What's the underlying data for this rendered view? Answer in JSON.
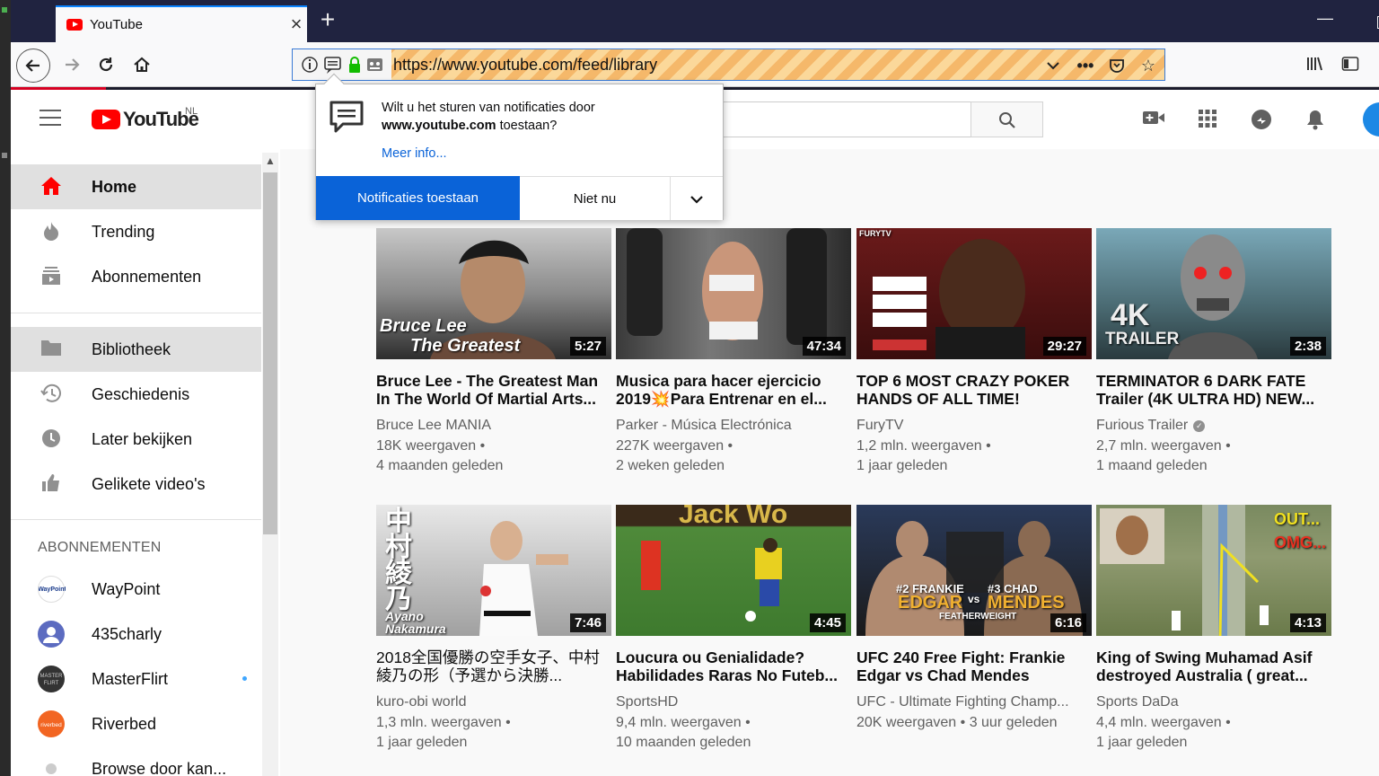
{
  "browser": {
    "tab_title": "YouTube",
    "url": "https://www.youtube.com/feed/library"
  },
  "notification": {
    "message_pre": "Wilt u het sturen van notificaties door",
    "domain": "www.youtube.com",
    "message_post": " toestaan?",
    "more_info": "Meer info...",
    "allow_label": "Notificaties toestaan",
    "not_now_label": "Niet nu"
  },
  "youtube": {
    "logo_word": "YouTube",
    "region": "NL"
  },
  "sidebar": {
    "items": [
      {
        "label": "Home",
        "icon": "home-icon"
      },
      {
        "label": "Trending",
        "icon": "flame-icon"
      },
      {
        "label": "Abonnementen",
        "icon": "subscriptions-icon"
      },
      {
        "label": "Bibliotheek",
        "icon": "folder-icon"
      },
      {
        "label": "Geschiedenis",
        "icon": "history-icon"
      },
      {
        "label": "Later bekijken",
        "icon": "clock-icon"
      },
      {
        "label": "Gelikete video's",
        "icon": "thumbs-up-icon"
      }
    ],
    "subs_heading": "ABONNEMENTEN",
    "subscriptions": [
      {
        "label": "WayPoint"
      },
      {
        "label": "435charly"
      },
      {
        "label": "MasterFlirt"
      },
      {
        "label": "Riverbed"
      },
      {
        "label": "Browse door kan..."
      }
    ]
  },
  "videos": [
    {
      "title": "Bruce Lee - The Greatest Man In The World Of Martial Arts...",
      "channel": "Bruce Lee MANIA",
      "views": "18K weergaven",
      "age": "4 maanden geleden",
      "duration": "5:27",
      "overlay": "Bruce Lee\nThe Greatest"
    },
    {
      "title": "Musica para hacer ejercicio 2019💥Para Entrenar en el...",
      "channel": "Parker - Música Electrónica",
      "views": "227K weergaven",
      "age": "2 weken geleden",
      "duration": "47:34",
      "overlay": ""
    },
    {
      "title": "TOP 6 MOST CRAZY POKER HANDS OF ALL TIME!",
      "channel": "FuryTV",
      "views": "1,2 mln. weergaven",
      "age": "1 jaar geleden",
      "duration": "29:27",
      "overlay": "FURYTV"
    },
    {
      "title": "TERMINATOR 6 DARK FATE Trailer (4K ULTRA HD) NEW...",
      "channel": "Furious Trailer",
      "views": "2,7 mln. weergaven",
      "age": "1 maand geleden",
      "duration": "2:38",
      "overlay": "4K TRAILER"
    },
    {
      "title": "2018全国優勝の空手女子、中村綾乃の形（予選から決勝...",
      "channel": "kuro-obi world",
      "views": "1,3 mln. weergaven",
      "age": "1 jaar geleden",
      "duration": "7:46",
      "overlay": "中村綾乃"
    },
    {
      "title": "Loucura ou Genialidade? Habilidades Raras No Futeb...",
      "channel": "SportsHD",
      "views": "9,4 mln. weergaven",
      "age": "10 maanden geleden",
      "duration": "4:45",
      "overlay": ""
    },
    {
      "title": "UFC 240 Free Fight: Frankie Edgar vs Chad Mendes",
      "channel": "UFC - Ultimate Fighting Champ...",
      "views": "20K weergaven",
      "age": "3 uur geleden",
      "duration": "6:16",
      "overlay": "#2 FRANKIE EDGAR vs #3 CHAD MENDES"
    },
    {
      "title": "King of Swing Muhamad Asif destroyed Australia ( great...",
      "channel": "Sports DaDa",
      "views": "4,4 mln. weergaven",
      "age": "1 jaar geleden",
      "duration": "4:13",
      "overlay": "OUT... OMG..."
    }
  ],
  "colors": {
    "brand_red": "#ff0000",
    "firefox_blue": "#0a63d8",
    "tabbar": "#202340"
  }
}
